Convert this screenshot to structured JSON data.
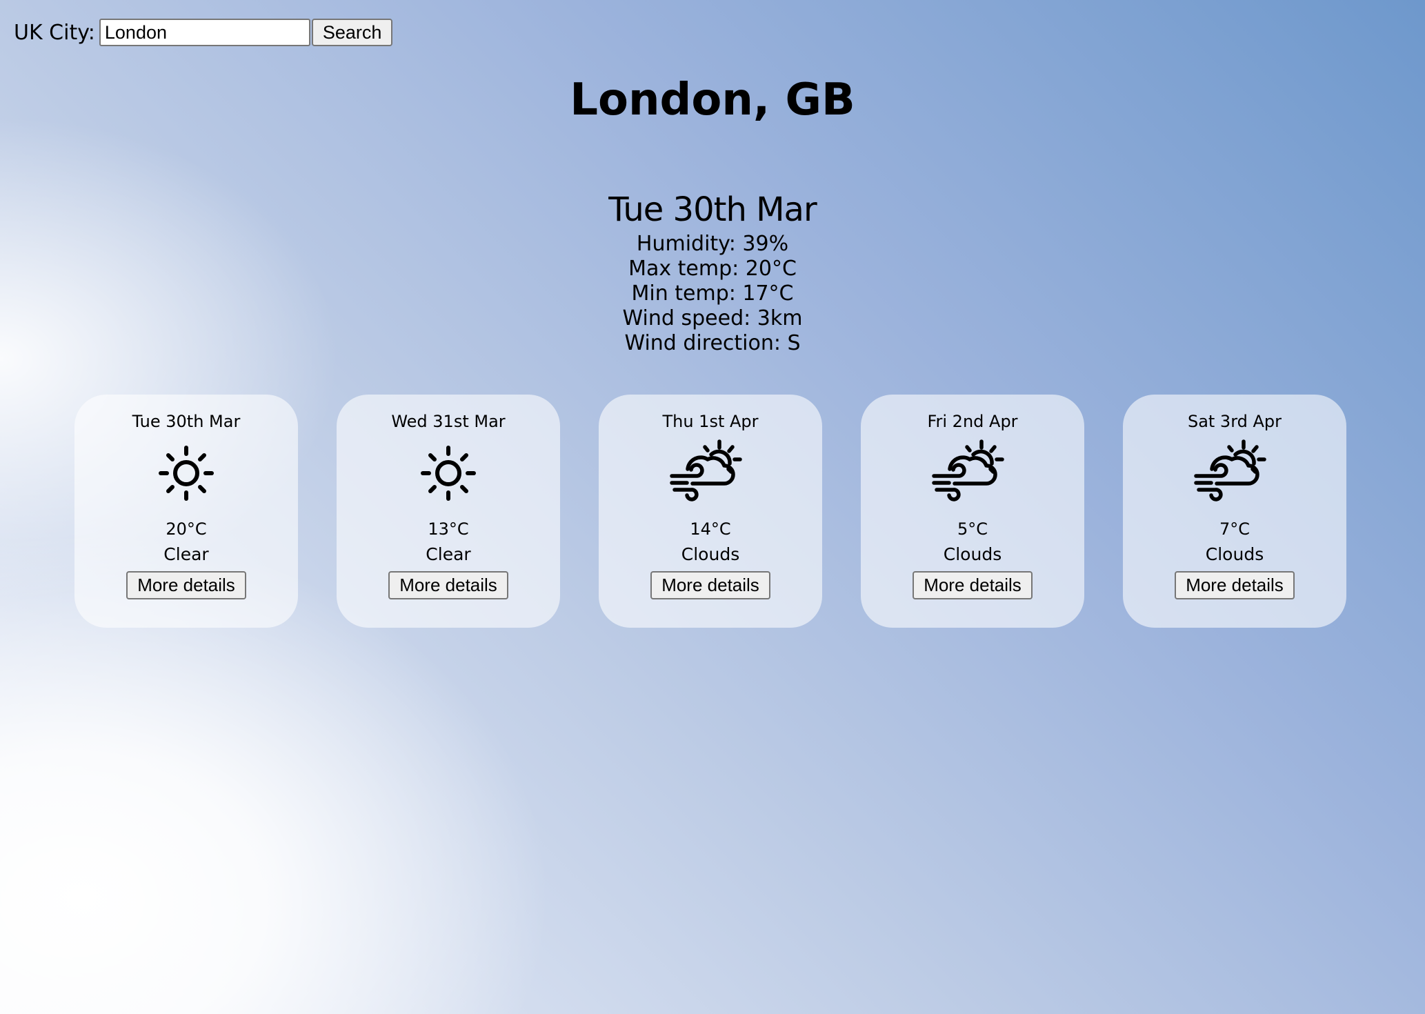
{
  "search": {
    "label": "UK City:",
    "value": "London",
    "button_label": "Search"
  },
  "location": {
    "title": "London, GB"
  },
  "current": {
    "date": "Tue 30th Mar",
    "humidity": "Humidity: 39%",
    "max_temp": "Max temp: 20°C",
    "min_temp": "Min temp: 17°C",
    "wind_speed": "Wind speed: 3km",
    "wind_direction": "Wind direction: S"
  },
  "forecast": [
    {
      "date": "Tue 30th Mar",
      "icon": "sun-icon",
      "temp": "20°C",
      "desc": "Clear",
      "button_label": "More details"
    },
    {
      "date": "Wed 31st Mar",
      "icon": "sun-icon",
      "temp": "13°C",
      "desc": "Clear",
      "button_label": "More details"
    },
    {
      "date": "Thu 1st Apr",
      "icon": "cloud-sun-wind-icon",
      "temp": "14°C",
      "desc": "Clouds",
      "button_label": "More details"
    },
    {
      "date": "Fri 2nd Apr",
      "icon": "cloud-sun-wind-icon",
      "temp": "5°C",
      "desc": "Clouds",
      "button_label": "More details"
    },
    {
      "date": "Sat 3rd Apr",
      "icon": "cloud-sun-wind-icon",
      "temp": "7°C",
      "desc": "Clouds",
      "button_label": "More details"
    }
  ]
}
